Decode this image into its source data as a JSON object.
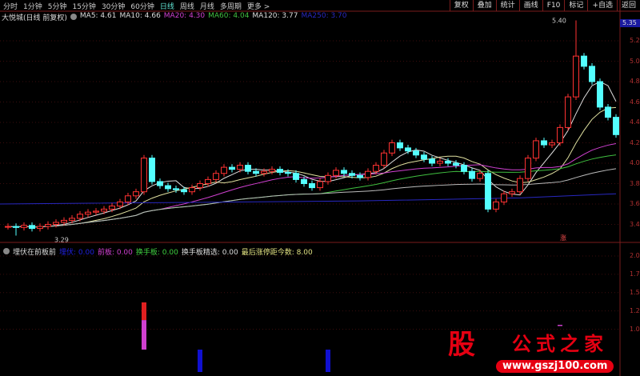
{
  "toolbar": {
    "periods": [
      "分时",
      "1分钟",
      "5分钟",
      "15分钟",
      "30分钟",
      "60分钟",
      "日线",
      "周线",
      "月线",
      "多周期",
      "更多 >"
    ],
    "active": "日线",
    "right_buttons": [
      "复权",
      "叠加",
      "统计",
      "画线",
      "F10",
      "标记",
      "+自选",
      "返回"
    ]
  },
  "legend": {
    "name": "大悦城(日线 前复权)",
    "ma": [
      {
        "label": "MA5: 4.61",
        "color": "#dddddd"
      },
      {
        "label": "MA10: 4.66",
        "color": "#dddddd"
      },
      {
        "label": "MA20: 4.30",
        "color": "#d040d0"
      },
      {
        "label": "MA60: 4.04",
        "color": "#40c040"
      },
      {
        "label": "MA120: 3.77",
        "color": "#dddddd"
      },
      {
        "label": "MA250: 3.70",
        "color": "#2828c0"
      }
    ]
  },
  "price_axis": {
    "current": "5.35",
    "ticks": [
      "5.20",
      "5.00",
      "4.80",
      "4.60",
      "4.40",
      "4.20",
      "4.00",
      "3.80",
      "3.60",
      "3.40"
    ]
  },
  "annotations": {
    "high": "5.40",
    "low": "3.29",
    "limit_up_mark": "涨"
  },
  "indicator": {
    "name": "埋伏在前板前",
    "items": [
      {
        "label": "埋伏: 0.00",
        "color": "#2020e0"
      },
      {
        "label": "前板: 0.00",
        "color": "#d040d0"
      },
      {
        "label": "换手板: 0.00",
        "color": "#40d040"
      },
      {
        "label": "换手板精选: 0.00",
        "color": "#dddddd"
      },
      {
        "label": "最后涨停距今数: 8.00",
        "color": "#e0e080"
      }
    ],
    "ticks": [
      "2.00",
      "1.75",
      "1.50",
      "1.25",
      "1.00"
    ]
  },
  "watermark": {
    "logo": "股",
    "title": "公式之家",
    "url": "www.gszj100.com"
  },
  "chart_data": {
    "type": "candlestick",
    "ylim": [
      3.25,
      5.45
    ],
    "closes": [
      3.38,
      3.37,
      3.39,
      3.36,
      3.38,
      3.4,
      3.42,
      3.44,
      3.46,
      3.5,
      3.52,
      3.53,
      3.55,
      3.58,
      3.62,
      3.68,
      3.72,
      4.05,
      3.82,
      3.78,
      3.75,
      3.74,
      3.72,
      3.76,
      3.8,
      3.84,
      3.9,
      3.96,
      3.94,
      3.98,
      3.92,
      3.9,
      3.92,
      3.94,
      3.91,
      3.9,
      3.84,
      3.8,
      3.76,
      3.82,
      3.88,
      3.93,
      3.9,
      3.88,
      3.86,
      3.92,
      3.98,
      4.1,
      4.2,
      4.15,
      4.12,
      4.08,
      4.04,
      4.0,
      4.02,
      4.0,
      3.98,
      3.92,
      3.85,
      3.9,
      3.55,
      3.62,
      3.7,
      3.72,
      3.85,
      4.05,
      4.22,
      4.18,
      4.2,
      4.35,
      4.65,
      5.05,
      4.95,
      4.8,
      4.55,
      4.45,
      4.28
    ],
    "indicator_bars": [
      {
        "index": 17,
        "segments": [
          {
            "from": 1.25,
            "to": 2.0,
            "color": "#e02020"
          },
          {
            "from": 0.0,
            "to": 1.25,
            "color": "#d040d0"
          }
        ]
      },
      {
        "index": 24,
        "segments": [
          {
            "from": -0.5,
            "to": 0.0,
            "color": "#1010d0"
          }
        ]
      },
      {
        "index": 40,
        "segments": [
          {
            "from": -0.5,
            "to": 0.0,
            "color": "#1010d0"
          }
        ]
      },
      {
        "index": 69,
        "segments": [
          {
            "from": 1.0,
            "to": 1.05,
            "color": "#d040d0"
          }
        ]
      }
    ]
  }
}
